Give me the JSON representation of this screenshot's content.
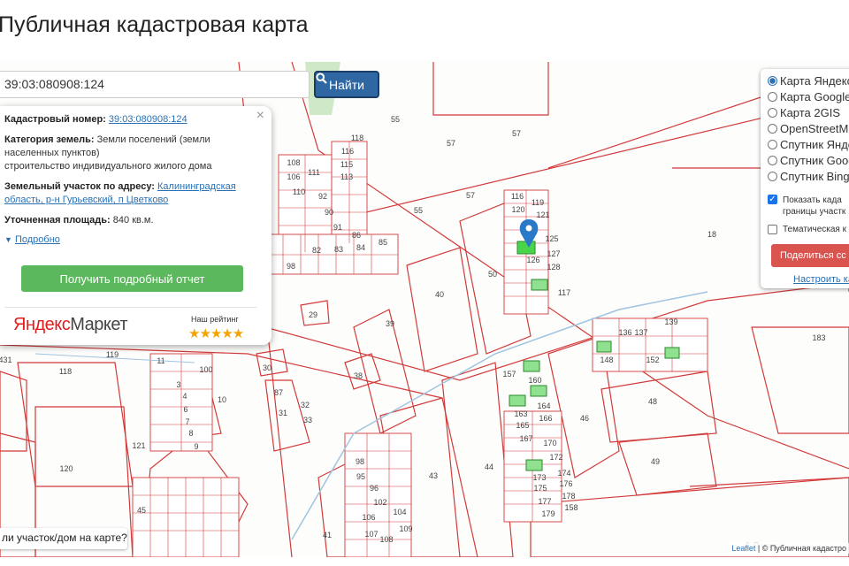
{
  "title": "Публичная кадастровая карта",
  "search": {
    "value": "39:03:080908:124",
    "button_label": "Найти"
  },
  "popup": {
    "cadastral_label": "Кадастровый номер:",
    "cadastral_value": "39:03:080908:124",
    "category_label": "Категория земель:",
    "category_value": "Земли поселений (земли населенных пунктов)",
    "category_use": "строительство индивидуального жилого дома",
    "address_label": "Земельный участок по адресу:",
    "address_value": "Калининградская область, р-н Гурьевский, п Цветково",
    "area_label": "Уточненная площадь:",
    "area_value": "840 кв.м.",
    "details_link": "Подробно",
    "report_button": "Получить подробный отчет",
    "market_logo_ya": "Яндекс",
    "market_logo_rest": "Маркет",
    "rating_label": "Наш рейтинг",
    "stars": "★★★★★"
  },
  "layers": {
    "options": [
      "Карта Яндекс",
      "Карта Google",
      "Карта 2GIS",
      "OpenStreetMap",
      "Спутник Яндекс",
      "Спутник Google",
      "Спутник Bing"
    ],
    "selected_index": 0,
    "show_borders_label_1": "Показать када",
    "show_borders_label_2": "границы участк",
    "show_borders_checked": true,
    "thematic_label": "Тематическая к",
    "thematic_checked": false,
    "share_button": "Поделиться сс",
    "configure_link": "Настроить ка"
  },
  "question": "ли участок/дом на карте?",
  "attribution": {
    "leaflet": "Leaflet",
    "rest": "| © Публичная кадастро"
  },
  "map_labels": [
    "55",
    "56",
    "57",
    "57",
    "55",
    "58",
    "18",
    "183",
    "50",
    "40",
    "39",
    "29",
    "30",
    "38",
    "119",
    "118",
    "121",
    "120",
    "41",
    "43",
    "44",
    "44",
    "46",
    "48",
    "49",
    "45",
    "87",
    "31",
    "32",
    "33",
    "11",
    "100",
    "10",
    "116",
    "119",
    "120",
    "121",
    "123",
    "125",
    "126",
    "127",
    "128",
    "117",
    "132",
    "136",
    "137",
    "139",
    "141",
    "145",
    "146",
    "147",
    "148",
    "150",
    "151",
    "152",
    "153",
    "157",
    "160",
    "163",
    "164",
    "165",
    "166",
    "167",
    "169",
    "170",
    "171",
    "172",
    "173",
    "174",
    "175",
    "176",
    "177",
    "178",
    "179",
    "158",
    "108",
    "109",
    "110",
    "107",
    "106",
    "105",
    "102",
    "101",
    "103",
    "104",
    "98",
    "99",
    "100",
    "96",
    "97",
    "95",
    "92",
    "91",
    "90",
    "93",
    "94",
    "89",
    "86",
    "84",
    "85",
    "83",
    "82",
    "81",
    "80",
    "118",
    "116",
    "115",
    "114",
    "113",
    "112",
    "111",
    "124",
    "153",
    "50",
    "124",
    "42",
    "61",
    "62",
    "63",
    "64",
    "65",
    "60",
    "59",
    "58",
    "57",
    "3",
    "4",
    "5",
    "6",
    "7",
    "8",
    "9",
    "2",
    "431",
    "98",
    "95"
  ],
  "colors": {
    "parcel_line": "#d23a3a",
    "selected_parcel": "#49d449",
    "pin": "#2a79c9",
    "search_button": "#2f67a3",
    "report_button": "#5cb85c",
    "share_button": "#d9534f"
  }
}
